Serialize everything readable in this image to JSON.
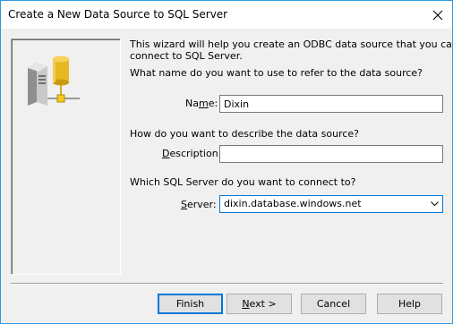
{
  "window": {
    "title": "Create a New Data Source to SQL Server"
  },
  "intro": {
    "line1": "This wizard will help you create an ODBC data source that you can use to",
    "line2": "connect to SQL Server."
  },
  "name_section": {
    "question": "What name do you want to use to refer to the data source?",
    "label_pre": "Na",
    "label_key": "m",
    "label_post": "e:",
    "value": "Dixin"
  },
  "description_section": {
    "question": "How do you want to describe the data source?",
    "label_key": "D",
    "label_post": "escription:",
    "value": ""
  },
  "server_section": {
    "question": "Which SQL Server do you want to connect to?",
    "label_key": "S",
    "label_post": "erver:",
    "value": "dixin.database.windows.net"
  },
  "buttons": {
    "finish": "Finish",
    "next_key": "N",
    "next_post": "ext >",
    "cancel": "Cancel",
    "help": "Help"
  },
  "icons": {
    "close": "close-icon",
    "dropdown": "chevron-down-icon",
    "wizard": "server-database-icon"
  },
  "colors": {
    "accent": "#0078d7",
    "window_border": "#2e9adb",
    "database": "#e8b822"
  }
}
